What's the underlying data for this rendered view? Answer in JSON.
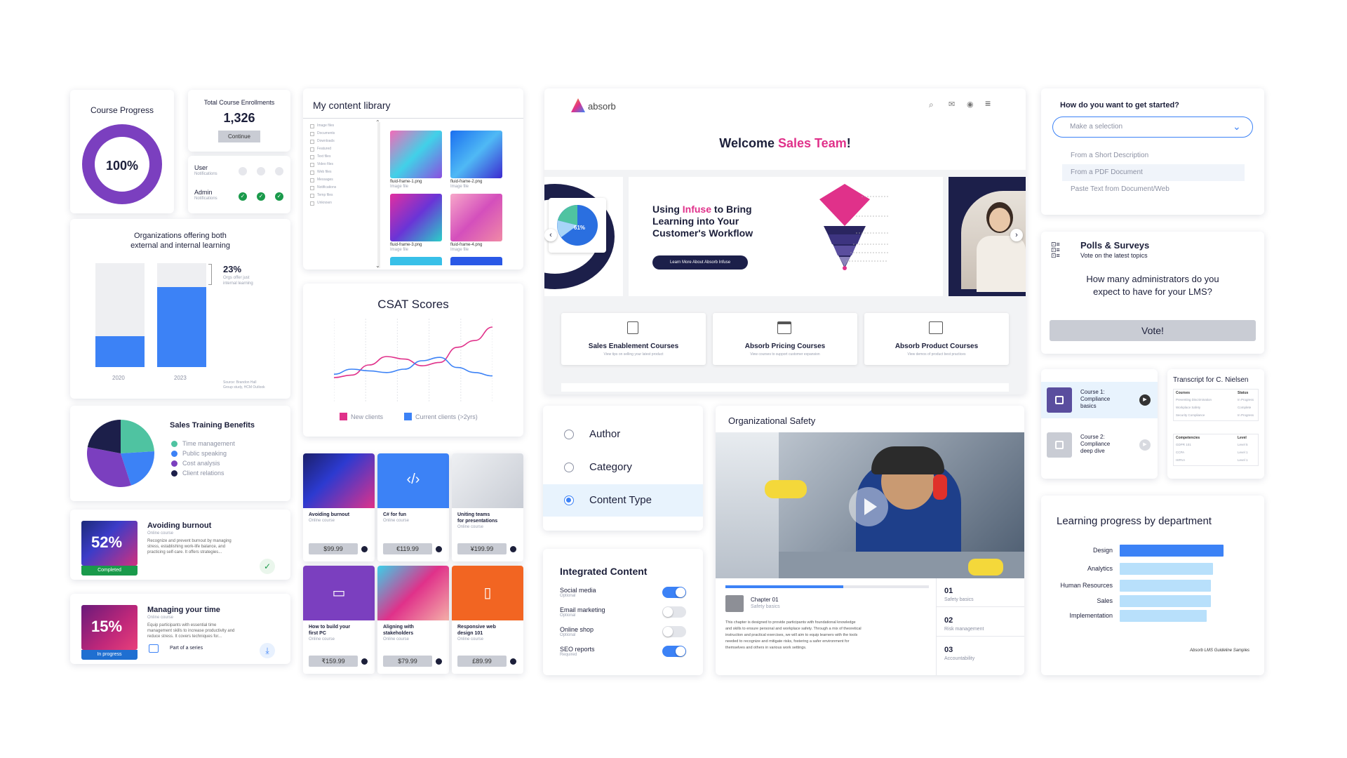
{
  "course_progress": {
    "title": "Course Progress",
    "percent_label": "100%",
    "value": 1.0
  },
  "enrollments": {
    "title": "Total Course Enrollments",
    "count": "1,326",
    "continue_label": "Continue"
  },
  "notifications": {
    "user_label": "User",
    "user_sub": "Notifications",
    "admin_label": "Admin",
    "admin_sub": "Notifications"
  },
  "orgs_chart": {
    "title_line1": "Organizations offering both",
    "title_line2": "external and internal learning",
    "pct": "23%",
    "note_line1": "Orgs offer just",
    "note_line2": "internal learning",
    "source_line1": "Source: Brandon Hall",
    "source_line2": "Group study, HCM Outlook"
  },
  "sales_training": {
    "title": "Sales Training Benefits",
    "items": [
      "Time management",
      "Public speaking",
      "Cost analysis",
      "Client relations"
    ]
  },
  "burnout": {
    "pct": "52%",
    "status": "Completed",
    "title": "Avoiding burnout",
    "sub": "Online course",
    "desc1": "Recognize and prevent burnout by managing",
    "desc2": "stress, establishing work-life balance, and",
    "desc3": "practicing self-care. It offers strategies..."
  },
  "time": {
    "pct": "15%",
    "status": "In progress",
    "title": "Managing your time",
    "sub": "Online course",
    "desc1": "Equip participants with essential time",
    "desc2": "management skills to increase productivity and",
    "desc3": "reduce stress. It covers techniques for...",
    "series": "Part of a series"
  },
  "library": {
    "title": "My content library",
    "filters": [
      "Image files",
      "Documents",
      "Downloads",
      "Featured",
      "Text files",
      "Video files",
      "Web files",
      "Messages",
      "Notifications",
      "Temp files",
      "Unknown"
    ],
    "files": [
      {
        "name": "fluid-frame-1.png",
        "type": "Image file"
      },
      {
        "name": "fluid-frame-2.png",
        "type": "Image file"
      },
      {
        "name": "fluid-frame-3.png",
        "type": "Image file"
      },
      {
        "name": "fluid-frame-4.png",
        "type": "Image file"
      }
    ]
  },
  "csat": {
    "title": "CSAT Scores",
    "legend": [
      "New clients",
      "Current clients (>2yrs)"
    ]
  },
  "shop": [
    {
      "title1": "Avoiding burnout",
      "title2": "",
      "sub": "Online course",
      "price": "$99.99"
    },
    {
      "title1": "C# for fun",
      "title2": "",
      "sub": "Online course",
      "price": "€119.99"
    },
    {
      "title1": "Uniting teams",
      "title2": "for presentations",
      "sub": "Online course",
      "price": "¥199.99"
    },
    {
      "title1": "How to build your",
      "title2": "first PC",
      "sub": "Online course",
      "price": "₹159.99"
    },
    {
      "title1": "Aligning with",
      "title2": "stakeholders",
      "sub": "Online course",
      "price": "$79.99"
    },
    {
      "title1": "Responsive web",
      "title2": "design 101",
      "sub": "Online course",
      "price": "£89.99"
    }
  ],
  "portal": {
    "logo": "absorb",
    "welcome_pre": "Welcome ",
    "welcome_accent": "Sales Team",
    "welcome_post": "!",
    "hero_l1_pre": "Using ",
    "hero_l1_accent": "Infuse",
    "hero_l1_post": " to Bring",
    "hero_l2": "Learning into Your",
    "hero_l3": "Customer's Workflow",
    "hero_btn": "Learn More About Absorb Infuse",
    "pie_label": "61%",
    "courses": [
      {
        "title": "Sales Enablement Courses",
        "sub": "View tips on selling your latest product"
      },
      {
        "title": "Absorb Pricing Courses",
        "sub": "View courses to support customer expansion"
      },
      {
        "title": "Absorb Product Courses",
        "sub": "View demos of product best practices"
      }
    ]
  },
  "radios": {
    "items": [
      "Author",
      "Category",
      "Content Type"
    ],
    "selected": 2
  },
  "integrated": {
    "title": "Integrated Content",
    "items": [
      {
        "label": "Social media",
        "sub": "Optional",
        "on": true
      },
      {
        "label": "Email marketing",
        "sub": "Optional",
        "on": false
      },
      {
        "label": "Online shop",
        "sub": "Optional",
        "on": false
      },
      {
        "label": "SEO reports",
        "sub": "Required",
        "on": true
      }
    ]
  },
  "org_safety": {
    "title": "Organizational Safety",
    "chapter": "Chapter 01",
    "chapter_sub": "Safety basics",
    "body1": "This chapter is designed to provide participants with foundational knowledge",
    "body2": "and skills to ensure personal and workplace safety. Through a mix of theoretical",
    "body3": "instruction and practical exercises, we will aim to equip learners with the tools",
    "body4": "needed to recognize and mitigate risks, fostering a safer environment for",
    "body5": "themselves and others in various work settings.",
    "progress": 0.58,
    "chapters": [
      {
        "num": "01",
        "label": "Safety basics"
      },
      {
        "num": "02",
        "label": "Risk management"
      },
      {
        "num": "03",
        "label": "Accountability"
      }
    ]
  },
  "getting_started": {
    "title": "How do you want to get started?",
    "select_placeholder": "Make a selection",
    "options": [
      "From a Short Description",
      "From a PDF Document",
      "Paste Text from Document/Web"
    ]
  },
  "polls": {
    "title": "Polls & Surveys",
    "sub": "Vote on the latest topics",
    "q1": "How many administrators do you",
    "q2": "expect to have for your LMS?",
    "vote": "Vote!"
  },
  "courses_list": [
    {
      "l1": "Course 1:",
      "l2": "Compliance",
      "l3": "basics"
    },
    {
      "l1": "Course 2:",
      "l2": "Compliance",
      "l3": "deep dive"
    }
  ],
  "transcript": {
    "title": "Transcript for C. Nielsen",
    "courses_header": "Courses",
    "status_header": "Status",
    "courses": [
      {
        "name": "Preventing Discrimination",
        "status": "In Progress"
      },
      {
        "name": "Workplace Safety",
        "status": "Complete"
      },
      {
        "name": "Security Compliance",
        "status": "In Progress"
      }
    ],
    "comp_header": "Competencies",
    "level_header": "Level",
    "comps": [
      {
        "name": "GDPR 101",
        "level": "Level 5"
      },
      {
        "name": "CCPA",
        "level": "Level 1"
      },
      {
        "name": "HIPAA",
        "level": "Level 1"
      }
    ]
  },
  "dept_chart": {
    "title": "Learning progress by department",
    "footer": "Absorb LMS Guideline Samples"
  },
  "chart_data": [
    {
      "type": "bar",
      "title": "Organizations offering both external and internal learning",
      "categories": [
        "2020",
        "2023"
      ],
      "values": [
        30,
        77
      ],
      "ylim": [
        0,
        100
      ],
      "annotation": "23%"
    },
    {
      "type": "pie",
      "title": "Sales Training Benefits",
      "labels": [
        "Time management",
        "Public speaking",
        "Cost analysis",
        "Client relations"
      ],
      "values": [
        24,
        21,
        33,
        22
      ],
      "colors": [
        "#4fc3a1",
        "#3c82f6",
        "#7b3fbf",
        "#1c1f4a"
      ]
    },
    {
      "type": "line",
      "title": "CSAT Scores",
      "x": [
        1,
        2,
        3,
        4,
        5,
        6,
        7,
        8,
        9,
        10
      ],
      "series": [
        {
          "name": "New clients",
          "values": [
            30,
            33,
            45,
            55,
            52,
            44,
            48,
            66,
            74,
            90
          ],
          "color": "#e0318a"
        },
        {
          "name": "Current clients (>2yrs)",
          "values": [
            34,
            40,
            38,
            36,
            40,
            50,
            54,
            42,
            36,
            32
          ],
          "color": "#3c82f6"
        }
      ]
    },
    {
      "type": "bar",
      "title": "Learning progress by department",
      "categories": [
        "Design",
        "Analytics",
        "Human Resources",
        "Sales",
        "Implementation"
      ],
      "values": [
        100,
        90,
        88,
        88,
        84
      ],
      "colors": [
        "#3c82f6",
        "#b8e0fb",
        "#b8e0fb",
        "#b8e0fb",
        "#b8e0fb"
      ]
    }
  ]
}
